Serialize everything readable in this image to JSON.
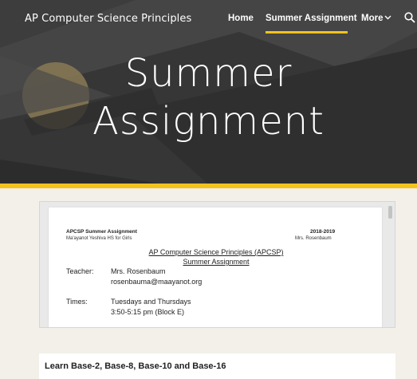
{
  "site": {
    "title": "AP Computer Science Principles"
  },
  "nav": {
    "items": [
      {
        "label": "Home",
        "active": false
      },
      {
        "label": "Summer Assignment",
        "active": true
      },
      {
        "label": "More",
        "active": false
      }
    ],
    "search_icon": "search-icon",
    "more_icon": "chevron-down-icon"
  },
  "hero": {
    "title_line1": "Summer",
    "title_line2": "Assignment"
  },
  "document": {
    "header_left_title": "APCSP Summer Assignment",
    "header_left_sub": "Ma'ayanot Yeshiva HS for Girls",
    "header_right_title": "2018-2019",
    "header_right_sub": "Mrs. Rosenbaum",
    "center_line1": "AP Computer Science Principles (APCSP)",
    "center_line2": "Summer Assignment",
    "teacher_label": "Teacher:",
    "teacher_name": "Mrs. Rosenbaum",
    "teacher_email": "rosenbauma@maayanot.org",
    "times_label": "Times:",
    "times_days": "Tuesdays and Thursdays",
    "times_hours": "3:50-5:15 pm (Block E)"
  },
  "section": {
    "title": "Learn Base-2, Base-8, Base-10 and Base-16"
  },
  "colors": {
    "accent": "#f2c31d",
    "hero_bg": "#3e3e3e",
    "page_bg": "#f3efe9"
  }
}
